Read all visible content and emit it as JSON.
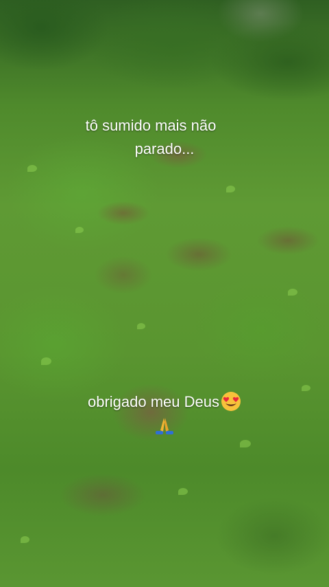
{
  "story": {
    "caption_line_1": "tô sumido mais não",
    "caption_line_2": "parado...",
    "caption_thanks": "obrigado meu Deus",
    "emoji_1": "smiling-face-with-heart-eyes-icon",
    "emoji_2": "folded-hands-icon"
  },
  "colors": {
    "caption_text": "#ffffff",
    "emoji_face": "#f7c23b",
    "emoji_heart": "#e8283c",
    "emoji_hands": "#f2b533",
    "emoji_sleeve": "#2f6fd6"
  }
}
